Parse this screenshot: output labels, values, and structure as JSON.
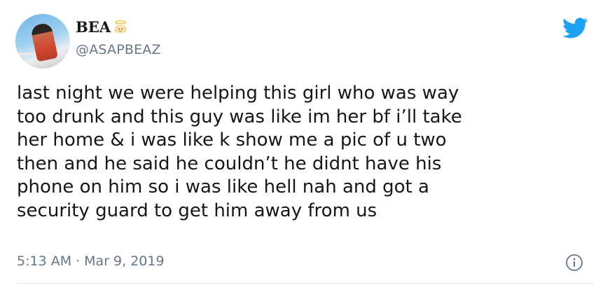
{
  "tweet": {
    "display_name": "BEA",
    "handle": "@ASAPBEAZ",
    "text": "last night we were helping this girl who was way\ntoo drunk and this guy was like im her bf i’ll take\nher home & i was like k show me a pic of u two\nthen and he said he couldn’t he didnt have his\nphone on him so i was like hell nah and got a\nsecurity guard to get him away from us",
    "time": "5:13 AM",
    "separator": "·",
    "date": "Mar 9, 2019"
  },
  "icons": {
    "brand": "twitter-bird-icon",
    "info": "info-icon",
    "name_emoji": "angel-emoji-icon"
  },
  "colors": {
    "brand": "#1da1f2",
    "text": "#14171a",
    "muted": "#657786"
  }
}
